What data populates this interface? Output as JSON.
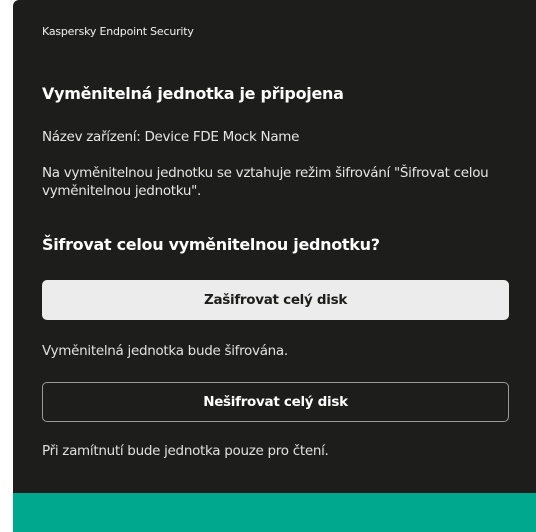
{
  "app": {
    "name": "Kaspersky Endpoint Security"
  },
  "dialog": {
    "title": "Vyměnitelná jednotka je připojena",
    "device_label": "Název zařízení:",
    "device_name": "Device FDE Mock Name",
    "policy_text": "Na vyměnitelnou jednotku se vztahuje režim šifrování \"Šifrovat celou vyměnitelnou jednotku\".",
    "question": "Šifrovat celou vyměnitelnou jednotku?",
    "encrypt_button": "Zašifrovat celý disk",
    "encrypt_hint": "Vyměnitelná jednotka bude šifrována.",
    "skip_button": "Nešifrovat celý disk",
    "skip_hint": "Při zamítnutí bude jednotka pouze pro čtení."
  },
  "colors": {
    "background": "#1d1d1b",
    "accent": "#00a88e",
    "primary_button": "#ececec"
  }
}
